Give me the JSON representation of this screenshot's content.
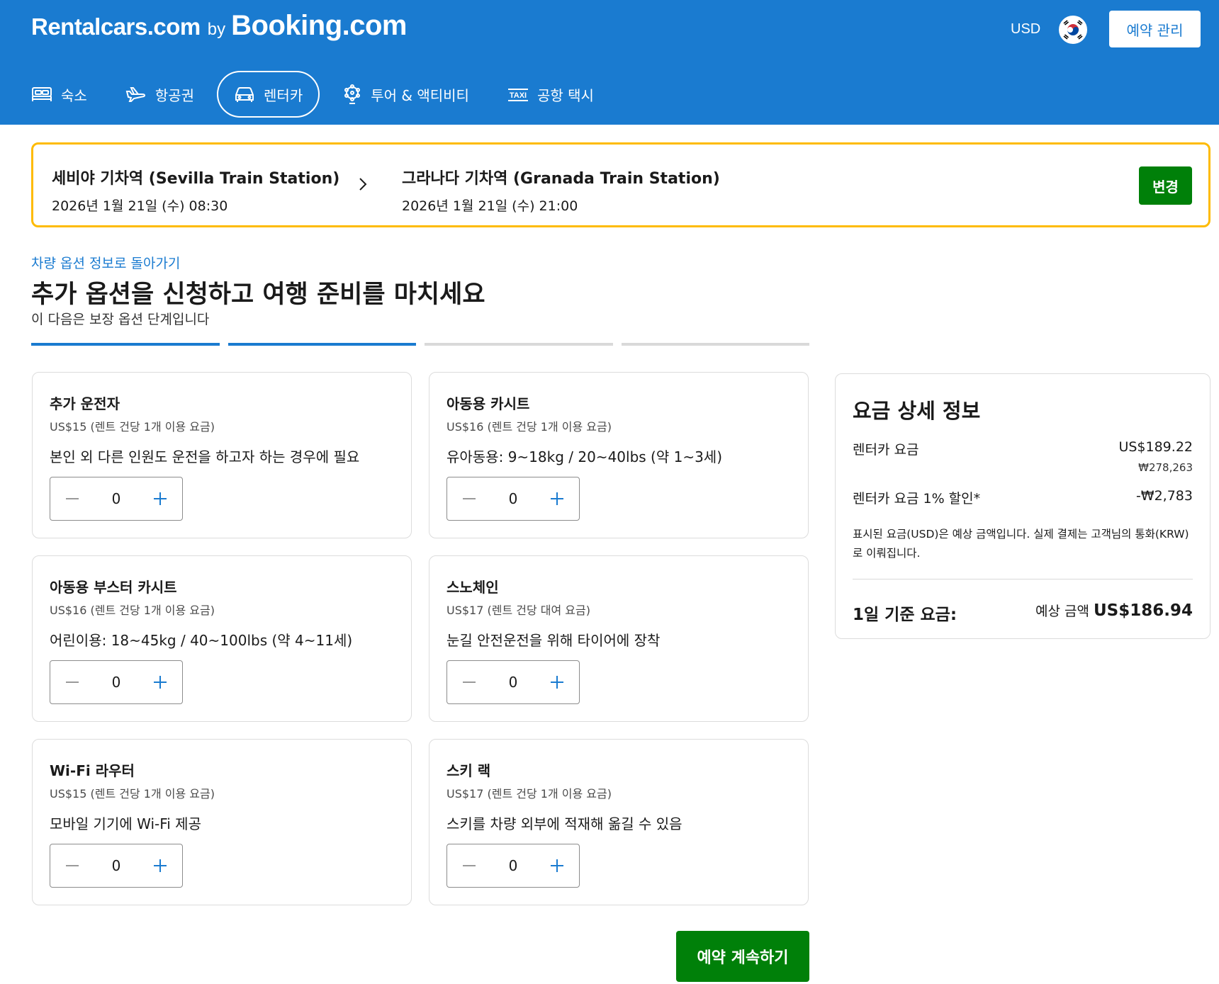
{
  "header": {
    "logo_rentalcars": "Rentalcars.com",
    "logo_by": "by",
    "logo_booking": "Booking.com",
    "currency": "USD",
    "flag_icon": "korea-flag-icon",
    "manage_booking": "예약 관리",
    "brand_color": "#1a7bd0"
  },
  "nav": {
    "items": [
      {
        "label": "숙소",
        "icon": "bed-icon",
        "active": false
      },
      {
        "label": "항공권",
        "icon": "plane-icon",
        "active": false
      },
      {
        "label": "렌터카",
        "icon": "car-icon",
        "active": true
      },
      {
        "label": "투어 & 액티비티",
        "icon": "attractions-icon",
        "active": false
      },
      {
        "label": "공항 택시",
        "icon": "taxi-icon",
        "active": false
      }
    ]
  },
  "route": {
    "pickup_name": "세비야 기차역 (Sevilla Train Station)",
    "pickup_datetime": "2026년 1월 21일 (수) 08:30",
    "dropoff_name": "그라나다 기차역 (Granada Train Station)",
    "dropoff_datetime": "2026년 1월 21일 (수) 21:00",
    "change_label": "변경",
    "border_color": "#febb02"
  },
  "main": {
    "back_link": "차량 옵션 정보로 돌아가기",
    "title": "추가 옵션을 신청하고 여행 준비를 마치세요",
    "subtitle": "이 다음은 보장 옵션 단계입니다",
    "steps_completed": 2,
    "steps_total": 4
  },
  "extras": [
    {
      "title": "추가 운전자",
      "price": "US$15 (렌트 건당 1개 이용 요금)",
      "desc": "본인 외 다른 인원도 운전을 하고자 하는 경우에 필요",
      "qty": "0"
    },
    {
      "title": "아동용 카시트",
      "price": "US$16 (렌트 건당 1개 이용 요금)",
      "desc": "유아동용: 9~18kg / 20~40lbs (약 1~3세)",
      "qty": "0"
    },
    {
      "title": "아동용 부스터 카시트",
      "price": "US$16 (렌트 건당 1개 이용 요금)",
      "desc": "어린이용: 18~45kg / 40~100lbs (약 4~11세)",
      "qty": "0"
    },
    {
      "title": "스노체인",
      "price": "US$17 (렌트 건당 대여 요금)",
      "desc": "눈길 안전운전을 위해 타이어에 장착",
      "qty": "0"
    },
    {
      "title": "Wi-Fi 라우터",
      "price": "US$15 (렌트 건당 1개 이용 요금)",
      "desc": "모바일 기기에 Wi-Fi 제공",
      "qty": "0"
    },
    {
      "title": "스키 랙",
      "price": "US$17 (렌트 건당 1개 이용 요금)",
      "desc": "스키를 차량 외부에 적재해 옮길 수 있음",
      "qty": "0"
    }
  ],
  "price_panel": {
    "title": "요금 상세 정보",
    "rental_label": "렌터카 요금",
    "rental_usd": "US$189.22",
    "rental_krw": "₩278,263",
    "discount_label": "렌터카 요금 1% 할인*",
    "discount_value": "-₩2,783",
    "note": "표시된 요금(USD)은 예상 금액입니다. 실제 결제는 고객님의 통화(KRW)로 이뤄집니다.",
    "total_label": "1일 기준 요금:",
    "total_est": "예상 금액",
    "total_amount": "US$186.94"
  },
  "continue_label": "예약 계속하기",
  "accent_green": "#008009"
}
